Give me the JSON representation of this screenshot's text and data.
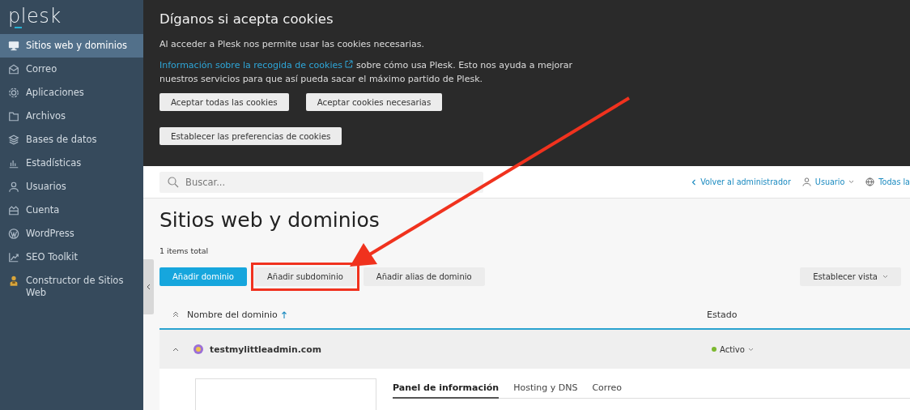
{
  "sidebar": {
    "logo": "plesk",
    "items": [
      {
        "label": "Sitios web y dominios",
        "selected": true
      },
      {
        "label": "Correo",
        "selected": false
      },
      {
        "label": "Aplicaciones",
        "selected": false
      },
      {
        "label": "Archivos",
        "selected": false
      },
      {
        "label": "Bases de datos",
        "selected": false
      },
      {
        "label": "Estadísticas",
        "selected": false
      },
      {
        "label": "Usuarios",
        "selected": false
      },
      {
        "label": "Cuenta",
        "selected": false
      },
      {
        "label": "WordPress",
        "selected": false
      },
      {
        "label": "SEO Toolkit",
        "selected": false
      },
      {
        "label": "Constructor de Sitios Web",
        "selected": false
      }
    ]
  },
  "cookie_banner": {
    "title": "Díganos si acepta cookies",
    "text": "Al acceder a Plesk nos permite usar las cookies necesarias.",
    "link": "Información sobre la recogida de cookies",
    "text_after": "sobre cómo usa Plesk. Esto nos ayuda a mejorar nuestros servicios para que así pueda sacar el máximo partido de Plesk.",
    "buttons": [
      "Aceptar todas las cookies",
      "Aceptar cookies necesarias",
      "Establecer las preferencias de cookies"
    ]
  },
  "topbar": {
    "search": {
      "placeholder": "Buscar..."
    },
    "links": [
      {
        "label": "Volver al administrador",
        "kind": "back"
      },
      {
        "label": "Usuario",
        "kind": "user"
      },
      {
        "label": "Todas la",
        "kind": "globe"
      }
    ]
  },
  "page": {
    "title": "Sitios web y dominios",
    "count": "1 items total",
    "toolbar": [
      {
        "label": "Añadir dominio",
        "kind": "primary",
        "highlighted": false
      },
      {
        "label": "Añadir subdominio",
        "kind": "default",
        "highlighted": true
      },
      {
        "label": "Añadir alias de dominio",
        "kind": "default",
        "highlighted": false
      }
    ],
    "view_button": "Establecer vista",
    "table": {
      "columns": [
        {
          "label": "Nombre del dominio",
          "sorted": true
        },
        {
          "label": "Estado",
          "sorted": false
        }
      ],
      "rows": [
        {
          "name": "testmylittleadmin.com",
          "expanded": true,
          "status": {
            "label": "Activo",
            "color": "#7cb82f"
          },
          "tabs": [
            {
              "label": "Panel de información",
              "selected": true
            },
            {
              "label": "Hosting y DNS",
              "selected": false
            },
            {
              "label": "Correo",
              "selected": false
            }
          ]
        }
      ]
    }
  }
}
